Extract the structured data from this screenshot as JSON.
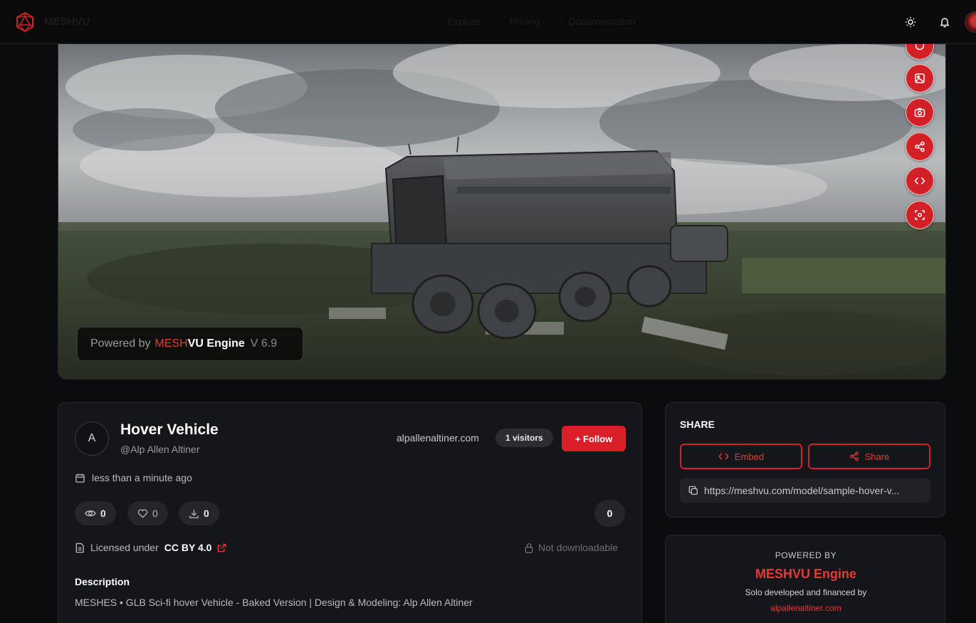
{
  "header": {
    "brand": "MESHVU",
    "nav": [
      "Explore",
      "Pricing",
      "Documentation"
    ]
  },
  "viewer": {
    "badge": {
      "prefix": "Powered by",
      "brand_red": "MESH",
      "brand_white": "VU Engine",
      "version": "V 6.9"
    },
    "tools": [
      "reset-view-icon",
      "image-icon",
      "camera-icon",
      "share-icon",
      "code-icon",
      "focus-icon"
    ]
  },
  "model": {
    "avatar_initial": "A",
    "title": "Hover Vehicle",
    "handle": "@Alp Allen Altiner",
    "website": "alpallenaltiner.com",
    "visitors": "1 visitors",
    "follow_label": "+ Follow",
    "uploaded": "less than a minute ago",
    "stats": {
      "views": "0",
      "likes": "0",
      "downloads": "0",
      "comments": "0"
    },
    "license_prefix": "Licensed under",
    "license_name": "CC BY 4.0",
    "download_status": "Not downloadable",
    "description_heading": "Description",
    "description": "MESHES • GLB Sci-fi hover Vehicle - Baked Version | Design & Modeling: Alp Allen Altiner"
  },
  "share": {
    "heading": "SHARE",
    "embed_label": "Embed",
    "share_label": "Share",
    "url": "https://meshvu.com/model/sample-hover-v..."
  },
  "powered": {
    "label": "POWERED BY",
    "name": "MESHVU Engine",
    "sub": "Solo developed and financed by",
    "link": "alpallenaltiner.com"
  },
  "colors": {
    "accent": "#d92028",
    "background": "#0b0c0e",
    "card": "#15161a"
  }
}
